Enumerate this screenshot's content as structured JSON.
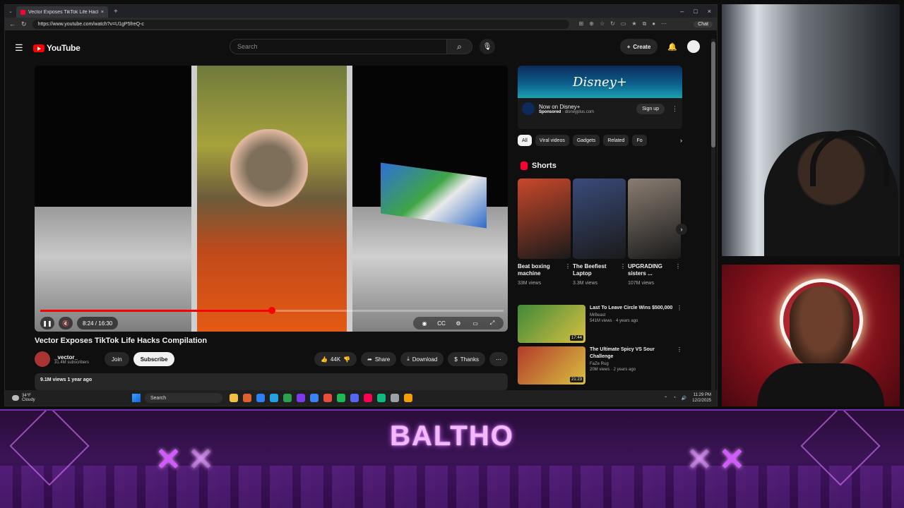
{
  "browser": {
    "tab_title": "Vector Exposes TikTok Life Hacks",
    "url": "https://www.youtube.com/watch?v=U1gP5freQ-c",
    "chat_label": "Chat",
    "window_controls": [
      "–",
      "□",
      "×"
    ]
  },
  "youtube": {
    "logo_text": "YouTube",
    "search_placeholder": "Search",
    "create_label": "Create",
    "player": {
      "time": "8:24 / 16:30",
      "progress": 0.5,
      "played_color": "#ff0000"
    },
    "video": {
      "title": "Vector Exposes TikTok Life Hacks Compilation",
      "channel": "_vector_",
      "subscribers": "31.4M subscribers",
      "join": "Join",
      "subscribe": "Subscribe",
      "likes": "44K",
      "share": "Share",
      "download": "Download",
      "thanks": "Thanks",
      "views_date": "9.1M views  1 year ago"
    },
    "ad": {
      "brand_text": "Disney+",
      "title": "Now on Disney+",
      "sponsored": "Sponsored",
      "domain": "disneyplus.com",
      "cta": "Sign up"
    },
    "chips": [
      "All",
      "Viral videos",
      "Gadgets",
      "Related",
      "Fo"
    ],
    "shorts_heading": "Shorts",
    "shorts": [
      {
        "title": "Beat boxing machine",
        "views": "33M views",
        "color": "#c9482a"
      },
      {
        "title": "The Beefiest Laptop",
        "views": "3.3M views",
        "color": "#3a4b7a"
      },
      {
        "title": "UPGRADING sisters ...",
        "views": "107M views",
        "color": "#8a7d72"
      }
    ],
    "recommendations": [
      {
        "title": "Last To Leave Circle Wins $500,000",
        "channel": "MrBeast",
        "meta": "541M views · 4 years ago",
        "duration": "17:44",
        "color": "#3f8a3a"
      },
      {
        "title": "The Ultimate Spicy VS Sour Challenge",
        "channel": "FaZe Rug",
        "meta": "20M views · 2 years ago",
        "duration": "21:23",
        "color": "#b33a2a"
      }
    ]
  },
  "taskbar": {
    "temp": "34°F",
    "condition": "Cloudy",
    "search": "Search",
    "time": "11:29 PM",
    "date": "12/2/2025",
    "app_colors": [
      "#f0c040",
      "#e06030",
      "#2d7ff9",
      "#25a0e0",
      "#2aa14a",
      "#7c3aed",
      "#3b82f6",
      "#e84c3d",
      "#1db954",
      "#5865f2",
      "#ff0050",
      "#10b981",
      "#9aa0a6",
      "#f59e0b"
    ]
  },
  "overlay": {
    "streamer_name": "BALTHO"
  }
}
